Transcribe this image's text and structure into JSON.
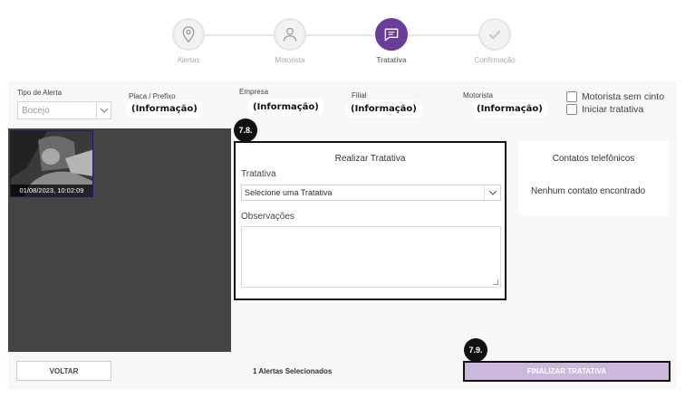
{
  "stepper": {
    "steps": [
      {
        "label": "Alertas",
        "icon": "location-pin-icon",
        "active": false
      },
      {
        "label": "Motorista",
        "icon": "person-icon",
        "active": false
      },
      {
        "label": "Tratativa",
        "icon": "chat-bubble-icon",
        "active": true
      },
      {
        "label": "Confirmação",
        "icon": "check-icon",
        "active": false
      }
    ],
    "active_color": "#6a3d9a"
  },
  "filters": {
    "tipo_alerta": {
      "label": "Tipo de Alerta",
      "value": "Bocejo"
    },
    "placa": {
      "label": "Placa / Prefixo",
      "value": "(Informação)"
    },
    "empresa": {
      "label": "Empresa",
      "value": "(Informação)"
    },
    "filial": {
      "label": "Filial",
      "value": "(Informação)"
    },
    "motorista": {
      "label": "Motorista",
      "value": "(Informação)"
    },
    "motorista_sem_cinto": "Motorista sem cinto",
    "iniciar_tratativa": "Iniciar tratativa"
  },
  "video": {
    "timestamp": "01/08/2023, 10:02:09"
  },
  "annotations": {
    "badge_tratativa": "7.8.",
    "badge_finalizar": "7.9."
  },
  "tratativa": {
    "title": "Realizar Tratativa",
    "select_label": "Tratativa",
    "select_value": "Selecione uma Tratativa",
    "observacoes_label": "Observações"
  },
  "contatos": {
    "title": "Contatos telefônicos",
    "empty": "Nenhum contato encontrado"
  },
  "footer": {
    "voltar": "VOLTAR",
    "selecionados": "1 Alertas Selecionados",
    "finalizar": "FINALIZAR TRATATIVA",
    "finalizar_color": "#cbb8dc"
  }
}
